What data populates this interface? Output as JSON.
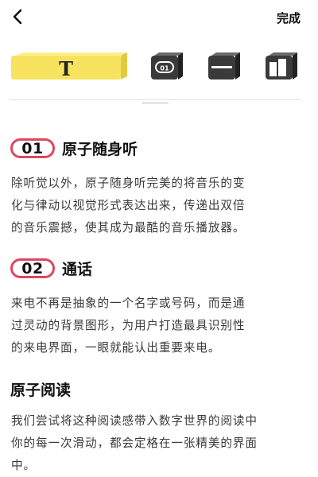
{
  "header": {
    "back_icon": "chevron-left-icon",
    "done_label": "完成"
  },
  "toolbar": {
    "tools": [
      {
        "icon": "text-style-icon",
        "glyph": "T",
        "selected": true,
        "color": "#f7e35f"
      },
      {
        "icon": "numbered-badge-style-icon",
        "glyph": "01",
        "selected": false,
        "color": "#3a3a3a"
      },
      {
        "icon": "bar-style-icon",
        "selected": false,
        "color": "#3a3a3a"
      },
      {
        "icon": "column-block-style-icon",
        "selected": false,
        "color": "#3a3a3a"
      }
    ]
  },
  "sections": [
    {
      "number": "01",
      "title": "原子随身听",
      "lines": [
        "除听觉以外，原子随身听完美的将音乐的变",
        "化与律动以视觉形式表达出来，传递出双倍",
        "的音乐震撼，使其成为最酷的音乐播放器。"
      ]
    },
    {
      "number": "02",
      "title": "通话",
      "lines": [
        "来电不再是抽象的一个名字或号码，而是通",
        "过灵动的背景图形，为用户打造最具识别性",
        "的来电界面，一眼就能认出重要来电。"
      ]
    },
    {
      "title": "原子阅读",
      "lines": [
        "我们尝试将这种阅读感带入数字世界的阅读中",
        "你的每一次滑动，都会定格在一张精美的界面",
        "中。"
      ]
    }
  ],
  "colors": {
    "accent_pill_border": "#e0455f",
    "selected_tool": "#f7e35f",
    "unselected_tool": "#3a3a3a"
  }
}
